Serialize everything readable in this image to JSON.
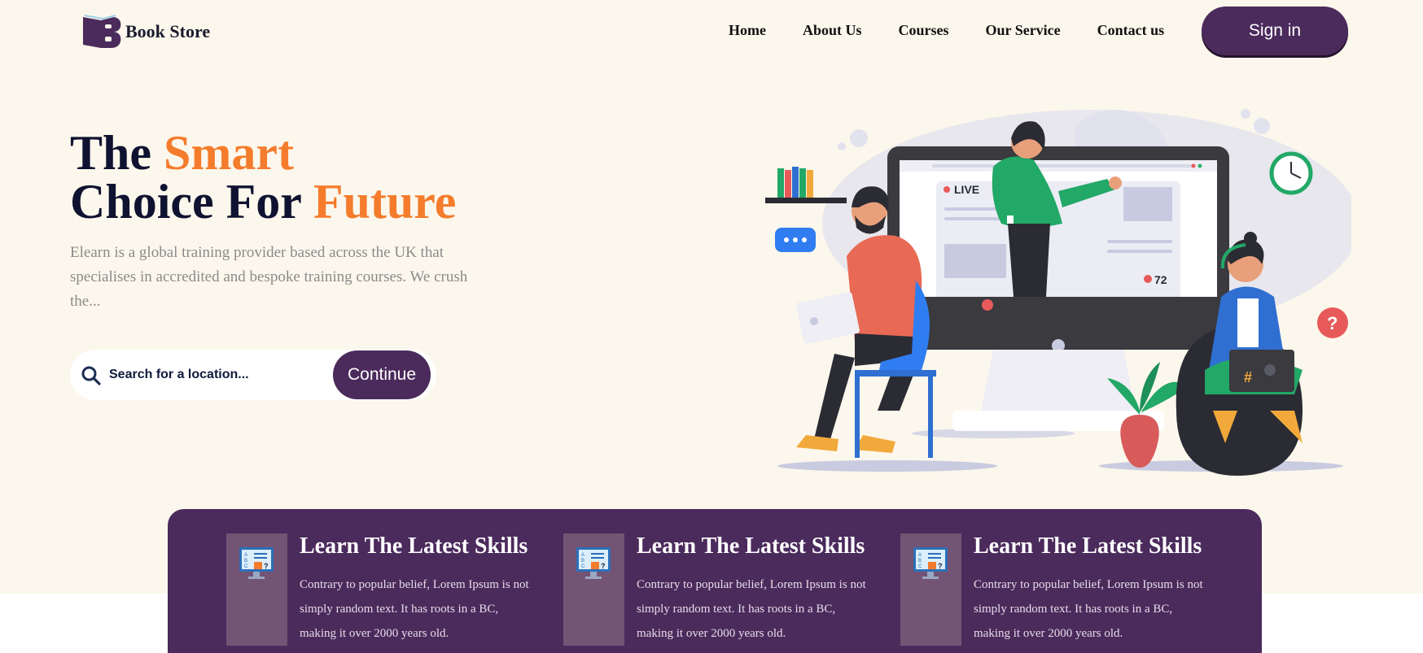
{
  "header": {
    "logo_text": "Book Store",
    "logo_icon": "book-logo-icon",
    "nav": [
      "Home",
      "About Us",
      "Courses",
      "Our Service",
      "Contact us"
    ],
    "signin_label": "Sign in"
  },
  "hero": {
    "title_line1_a": "The",
    "title_line1_b": "Smart",
    "title_line2_a": "Choice For",
    "title_line2_b": "Future",
    "description": "Elearn is a global training provider based across the UK that specialises in accredited and bespoke training courses. We crush the...",
    "search_placeholder": "Search for a location...",
    "search_icon": "search-icon",
    "continue_label": "Continue",
    "illustration": {
      "live_label": "LIVE",
      "viewer_count": "72"
    }
  },
  "features": [
    {
      "icon": "quiz-monitor-icon",
      "title": "Learn The Latest Skills",
      "text": "Contrary to popular belief, Lorem Ipsum is not simply random text. It has roots in a BC, making it over 2000 years old."
    },
    {
      "icon": "quiz-monitor-icon",
      "title": "Learn The Latest Skills",
      "text": "Contrary to popular belief, Lorem Ipsum is not simply random text. It has roots in a BC, making it over 2000 years old."
    },
    {
      "icon": "quiz-monitor-icon",
      "title": "Learn The Latest Skills",
      "text": "Contrary to popular belief, Lorem Ipsum is not simply random text. It has roots in a BC, making it over 2000 years old."
    }
  ],
  "colors": {
    "primary": "#4b2a5c",
    "accent": "#f47c2c",
    "hero_bg": "#fcf7ec",
    "heading": "#0f1230"
  }
}
